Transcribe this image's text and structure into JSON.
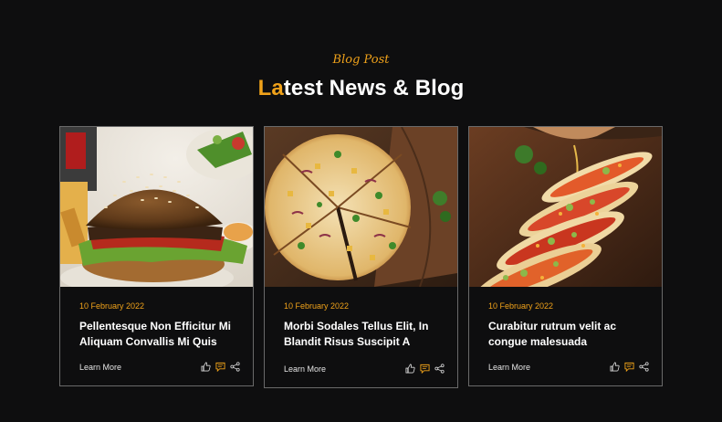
{
  "section": {
    "eyebrow": "Blog Post",
    "title_accent": "La",
    "title_rest": "test News & Blog"
  },
  "colors": {
    "accent": "#f0a21a",
    "background": "#0e0e0f",
    "card_border": "#6a6a6a"
  },
  "cards": [
    {
      "image": "burger-photo",
      "date": "10 February 2022",
      "title": "Pellentesque Non Efficitur Mi Aliquam Convallis Mi Quis",
      "link": "Learn More",
      "actions": [
        "thumbs-up-icon",
        "comment-icon",
        "share-icon"
      ]
    },
    {
      "image": "pizza-photo",
      "date": "10 February 2022",
      "title": "Morbi Sodales Tellus Elit, In Blandit Risus Suscipit A",
      "link": "Learn More",
      "actions": [
        "thumbs-up-icon",
        "comment-icon",
        "share-icon"
      ]
    },
    {
      "image": "tacos-photo",
      "date": "10 February 2022",
      "title": "Curabitur rutrum velit ac congue malesuada",
      "link": "Learn More",
      "actions": [
        "thumbs-up-icon",
        "comment-icon",
        "share-icon"
      ]
    }
  ]
}
